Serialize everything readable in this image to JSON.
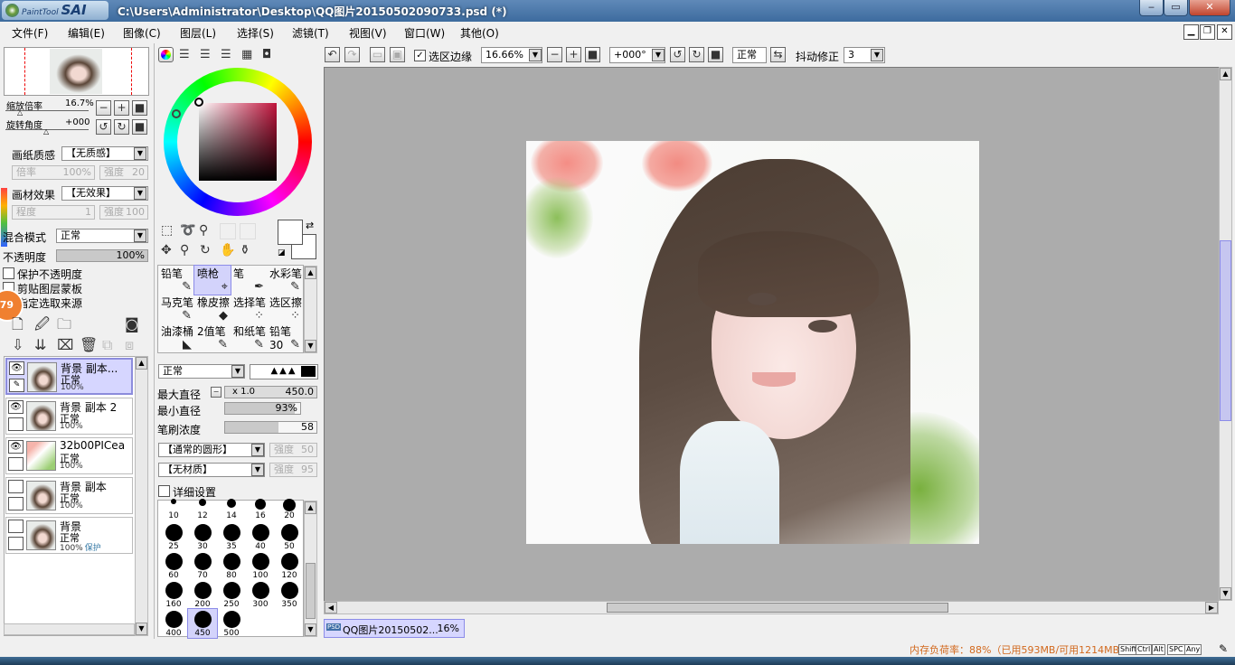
{
  "app": {
    "logo_small": "PaintTool",
    "logo_big": "SAI",
    "title": "C:\\Users\\Administrator\\Desktop\\QQ图片20150502090733.psd (*)"
  },
  "window_buttons": {
    "minimize": "‒",
    "maximize": "▭",
    "close": "✕"
  },
  "menu": [
    "文件(F)",
    "编辑(E)",
    "图像(C)",
    "图层(L)",
    "选择(S)",
    "滤镜(T)",
    "视图(V)",
    "窗口(W)",
    "其他(O)"
  ],
  "mdi_buttons": {
    "minimize": "▁",
    "restore": "❐",
    "close": "✕"
  },
  "navigator": {
    "zoom_label": "缩放倍率",
    "zoom_value": "16.7%",
    "rotate_label": "旋转角度",
    "rotate_value": "+000"
  },
  "paper": {
    "texture_label": "画纸质感",
    "texture_value": "【无质感】",
    "scale_label": "倍率",
    "scale_value": "100%",
    "strength_label": "强度",
    "strength_value": "20"
  },
  "effect": {
    "label": "画材效果",
    "value": "【无效果】",
    "width_label": "程度",
    "width_value": "1",
    "strength_label": "强度",
    "strength_value": "100"
  },
  "blend": {
    "label": "混合模式",
    "value": "正常",
    "opacity_label": "不透明度",
    "opacity_value": "100%",
    "opacity_fraction": 1.0
  },
  "layer_options": [
    "保护不透明度",
    "剪贴图层蒙板",
    "指定选取来源"
  ],
  "badge": "79",
  "layers": [
    {
      "name": "背景 副本...",
      "mode": "正常",
      "opacity": "100%",
      "visible": true,
      "selected": true,
      "protect": ""
    },
    {
      "name": "背景 副本 2",
      "mode": "正常",
      "opacity": "100%",
      "visible": true,
      "selected": false,
      "protect": ""
    },
    {
      "name": "32b00PICea",
      "mode": "正常",
      "opacity": "100%",
      "visible": true,
      "selected": false,
      "protect": ""
    },
    {
      "name": "背景 副本",
      "mode": "正常",
      "opacity": "100%",
      "visible": false,
      "selected": false,
      "protect": ""
    },
    {
      "name": "背景",
      "mode": "正常",
      "opacity": "100%",
      "visible": false,
      "selected": false,
      "protect": "保护"
    }
  ],
  "tools": [
    {
      "label": "铅笔",
      "icon": "✎",
      "selected": false
    },
    {
      "label": "喷枪",
      "icon": "⌖",
      "selected": true
    },
    {
      "label": "笔",
      "icon": "✒",
      "selected": false
    },
    {
      "label": "水彩笔",
      "icon": "✎",
      "selected": false
    },
    {
      "label": "马克笔",
      "icon": "✎",
      "selected": false
    },
    {
      "label": "橡皮擦",
      "icon": "◆",
      "selected": false
    },
    {
      "label": "选择笔",
      "icon": "⁘",
      "selected": false
    },
    {
      "label": "选区擦",
      "icon": "⁘",
      "selected": false
    },
    {
      "label": "油漆桶",
      "icon": "◣",
      "selected": false
    },
    {
      "label": "2值笔",
      "icon": "✎",
      "selected": false
    },
    {
      "label": "和纸笔",
      "icon": "✎",
      "selected": false
    },
    {
      "label": "铅笔30",
      "icon": "✎",
      "selected": false
    }
  ],
  "brush": {
    "mode": "正常",
    "max_size_label": "最大直径",
    "max_size_mult": "x 1.0",
    "max_size_value": "450.0",
    "min_size_label": "最小直径",
    "min_size_value": "93%",
    "min_size_fraction": 0.93,
    "density_label": "笔刷浓度",
    "density_value": "58",
    "density_fraction": 0.58,
    "shape_value": "【通常的圆形】",
    "shape_strength_label": "强度",
    "shape_strength_value": "50",
    "texture_value": "【无材质】",
    "texture_strength_label": "强度",
    "texture_strength_value": "95",
    "advanced_label": "详细设置"
  },
  "brush_sizes_top": [
    "10",
    "12",
    "14",
    "16",
    "20"
  ],
  "brush_sizes": [
    {
      "v": "25",
      "sel": false
    },
    {
      "v": "30",
      "sel": false
    },
    {
      "v": "35",
      "sel": false
    },
    {
      "v": "40",
      "sel": false
    },
    {
      "v": "50",
      "sel": false
    },
    {
      "v": "60",
      "sel": false
    },
    {
      "v": "70",
      "sel": false
    },
    {
      "v": "80",
      "sel": false
    },
    {
      "v": "100",
      "sel": false
    },
    {
      "v": "120",
      "sel": false
    },
    {
      "v": "160",
      "sel": false
    },
    {
      "v": "200",
      "sel": false
    },
    {
      "v": "250",
      "sel": false
    },
    {
      "v": "300",
      "sel": false
    },
    {
      "v": "350",
      "sel": false
    },
    {
      "v": "400",
      "sel": false
    },
    {
      "v": "450",
      "sel": true
    },
    {
      "v": "500",
      "sel": false
    }
  ],
  "toolbar": {
    "selection_edge_label": "选区边缘",
    "zoom": "16.66%",
    "rotation": "+000°",
    "mode": "正常",
    "stabilizer_label": "抖动修正",
    "stabilizer_value": "3"
  },
  "document_tab": {
    "icon": "PSD",
    "name": "QQ图片20150502...",
    "zoom": "16%"
  },
  "status": {
    "memory": "内存负荷率：88%（已用593MB/可用1214MB）",
    "keys": [
      "Shift",
      "Ctrl",
      "Alt",
      "SPC",
      "Any"
    ]
  },
  "colors": {
    "accent": "#8c8ce8",
    "selection": "#d3d3fb",
    "canvas_bg": "#acacac",
    "status_text": "#d2691e",
    "badge": "#f08030"
  }
}
